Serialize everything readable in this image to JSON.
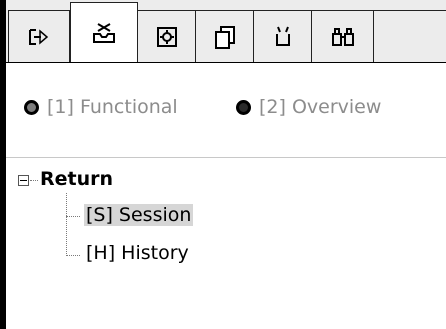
{
  "tabs": [
    {
      "icon": "exit-arrow-icon",
      "active": false
    },
    {
      "icon": "inbox-tray-icon",
      "active": true
    },
    {
      "icon": "document-settings-icon",
      "active": false
    },
    {
      "icon": "stacked-pages-icon",
      "active": false
    },
    {
      "icon": "cup-icon",
      "active": false
    },
    {
      "icon": "binoculars-icon",
      "active": false
    }
  ],
  "modes": [
    {
      "label": "[1] Functional",
      "selected": true
    },
    {
      "label": "[2] Overview",
      "selected": false
    }
  ],
  "tree": {
    "root": {
      "label": "Return",
      "expanded": true
    },
    "children": [
      {
        "label": "[S] Session",
        "selected": true
      },
      {
        "label": "[H] History",
        "selected": false
      }
    ]
  },
  "colors": {
    "tab_background": "#ececec",
    "selection_highlight": "#d6d6d6",
    "disabled_text": "#8c8c8c"
  }
}
